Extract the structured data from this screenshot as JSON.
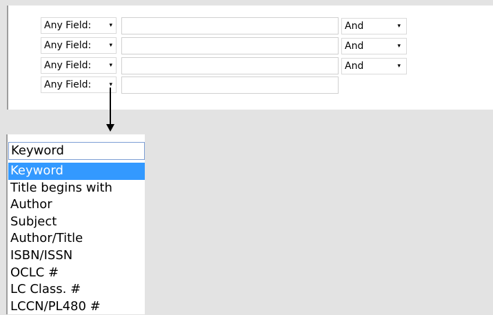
{
  "search_form": {
    "rows": [
      {
        "field": "Any Field:",
        "operator": "And"
      },
      {
        "field": "Any Field:",
        "operator": "And"
      },
      {
        "field": "Any Field:",
        "operator": "And"
      },
      {
        "field": "Any Field:"
      }
    ],
    "arrow_glyph": "▾"
  },
  "dropdown": {
    "current_value": "Keyword",
    "options": [
      "Keyword",
      "Title begins with",
      "Author",
      "Subject",
      "Author/Title",
      "ISBN/ISSN",
      "OCLC #",
      "LC Class. #",
      "LCCN/PL480 #"
    ],
    "highlight_color": "#3399ff"
  }
}
